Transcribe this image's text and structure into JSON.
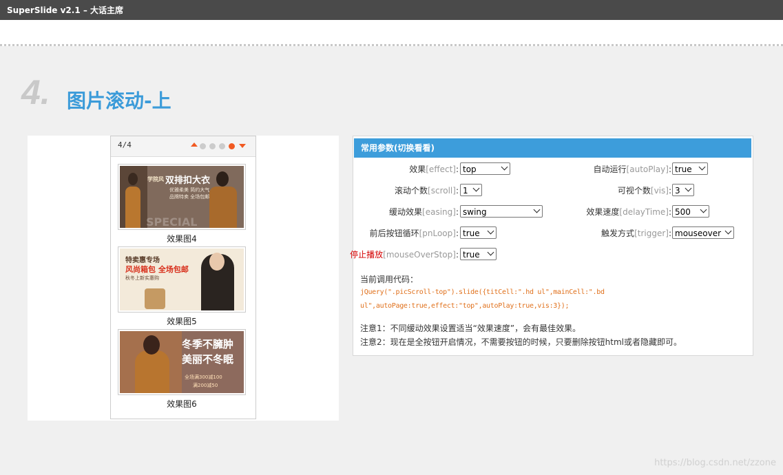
{
  "topbar": {
    "title": "SuperSlide v2.1 – 大话主席"
  },
  "section": {
    "number": "4.",
    "title": "图片滚动-上"
  },
  "demo": {
    "page_indicator": "4/4",
    "dots_total": 4,
    "active_dot": 4,
    "items": [
      {
        "caption": "效果图4",
        "banner_main": "双排扣大衣",
        "banner_brand": "学院风",
        "banner_sub1": "优雅柔美 简约大气",
        "banner_sub2": "品牌特卖 全场包邮",
        "banner_bg": "SPECIAL"
      },
      {
        "caption": "效果图5",
        "banner_main": "风尚箱包 全场包邮",
        "banner_brand": "特卖惠专场",
        "banner_sub1": "秋冬上新实惠购"
      },
      {
        "caption": "效果图6",
        "banner_main": "冬季不臃肿",
        "banner_main2": "美丽不冬眠",
        "banner_sub1": "全场满300减100",
        "banner_sub2": "满200减50"
      }
    ],
    "colors": {
      "accent": "#f15a22",
      "dot_inactive": "#cccccc"
    }
  },
  "params": {
    "heading": "常用参数(切换看看)",
    "rows": [
      {
        "cn": "效果",
        "en": "[effect]",
        "value": "top"
      },
      {
        "cn": "自动运行",
        "en": "[autoPlay]",
        "value": "true"
      },
      {
        "cn": "滚动个数",
        "en": "[scroll]",
        "value": "1"
      },
      {
        "cn": "可视个数",
        "en": "[vis]",
        "value": "3"
      },
      {
        "cn": "缓动效果",
        "en": "[easing]",
        "value": "swing"
      },
      {
        "cn": "效果速度",
        "en": "[delayTime]",
        "value": "500"
      },
      {
        "cn": "前后按钮循环",
        "en": "[pnLoop]",
        "value": "true"
      },
      {
        "cn": "触发方式",
        "en": "[trigger]",
        "value": "mouseover"
      },
      {
        "cn": "停止播放",
        "en": "[mouseOverStop]",
        "value": "true"
      }
    ],
    "code_label": "当前调用代码：",
    "code_line1": "jQuery(\".picScroll-top\").slide({titCell:\".hd ul\",mainCell:\".bd",
    "code_line2": "ul\",autoPage:true,effect:\"top\",autoPlay:true,vis:3});",
    "note1": "注意1：不同缓动效果设置适当“效果速度”，会有最佳效果。",
    "note2": "注意2：现在是全按钮开启情况，不需要按钮的时候，只要删除按钮html或者隐藏即可。",
    "colors": {
      "header_bg": "#3d9ddb",
      "code": "#e0701b",
      "stop_label": "#d40000"
    }
  },
  "watermark": "https://blog.csdn.net/zzone"
}
